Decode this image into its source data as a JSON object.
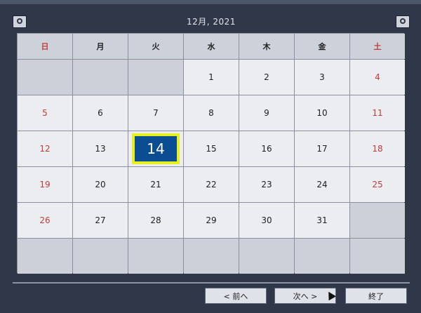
{
  "header": {
    "title": "12月, 2021"
  },
  "weekdays": [
    {
      "label": "日",
      "red": true
    },
    {
      "label": "月",
      "red": false
    },
    {
      "label": "火",
      "red": false
    },
    {
      "label": "水",
      "red": false
    },
    {
      "label": "木",
      "red": false
    },
    {
      "label": "金",
      "red": false
    },
    {
      "label": "土",
      "red": true
    }
  ],
  "days": [
    "",
    "",
    "",
    "1",
    "2",
    "3",
    "4",
    "5",
    "6",
    "7",
    "8",
    "9",
    "10",
    "11",
    "12",
    "13",
    "14",
    "15",
    "16",
    "17",
    "18",
    "19",
    "20",
    "21",
    "22",
    "23",
    "24",
    "25",
    "26",
    "27",
    "28",
    "29",
    "30",
    "31",
    "",
    "",
    "",
    "",
    "",
    "",
    "",
    ""
  ],
  "selected_day": "14",
  "colors": {
    "selected_bg": "#0b4d93",
    "selected_border": "#e9ee1e",
    "weekend": "#c23b3b"
  },
  "buttons": {
    "prev": "< 前へ",
    "next": "次へ >",
    "close": "終了"
  }
}
